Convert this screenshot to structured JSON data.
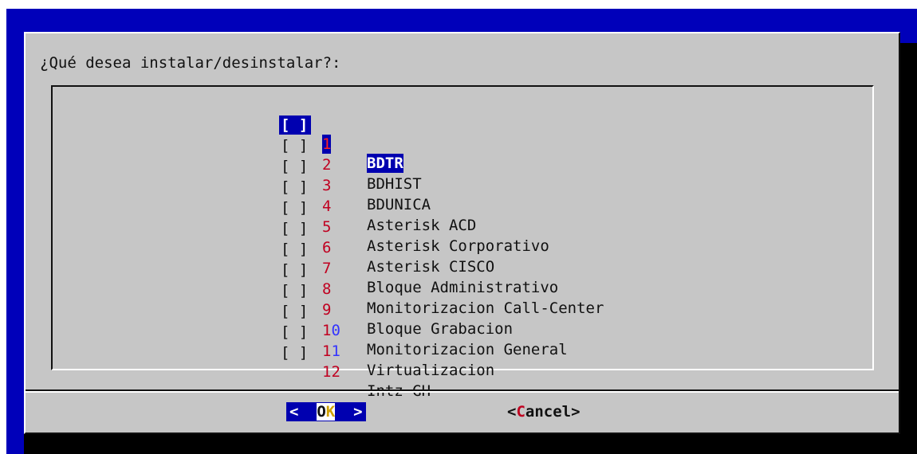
{
  "dialog": {
    "title": "¿Qué desea instalar/desinstalar?:",
    "items": [
      {
        "checkbox": "[ ]",
        "num": "1",
        "label": "BDTR",
        "selected": true
      },
      {
        "checkbox": "[ ]",
        "num": "2",
        "label": "BDHIST"
      },
      {
        "checkbox": "[ ]",
        "num": "3",
        "label": "BDUNICA"
      },
      {
        "checkbox": "[ ]",
        "num": "4",
        "label": "Asterisk ACD"
      },
      {
        "checkbox": "[ ]",
        "num": "5",
        "label": "Asterisk Corporativo"
      },
      {
        "checkbox": "[ ]",
        "num": "6",
        "label": "Asterisk CISCO"
      },
      {
        "checkbox": "[ ]",
        "num": "7",
        "label": "Bloque Administrativo"
      },
      {
        "checkbox": "[ ]",
        "num": "8",
        "label": "Monitorizacion Call-Center"
      },
      {
        "checkbox": "[ ]",
        "num": "9",
        "label": "Bloque Grabacion"
      },
      {
        "checkbox": "[ ]",
        "num_a": "1",
        "num_b": "0",
        "label": "Monitorizacion General"
      },
      {
        "checkbox": "[ ]",
        "num_a": "1",
        "num_b": "1",
        "label": "Virtualizacion"
      },
      {
        "checkbox": "[ ]",
        "num_a": "1",
        "num_b": "2",
        "label": "Intz-GH"
      }
    ],
    "buttons": {
      "ok_left": "<  ",
      "ok_o": "O",
      "ok_k": "K",
      "ok_right": "  >",
      "cancel_left": "<",
      "cancel_hot": "C",
      "cancel_rest": "ancel>"
    }
  },
  "colors": {
    "background": "#0000ba",
    "dialog": "#c6c6c6",
    "selection": "#0000b0",
    "hotkey": "#c00020"
  }
}
